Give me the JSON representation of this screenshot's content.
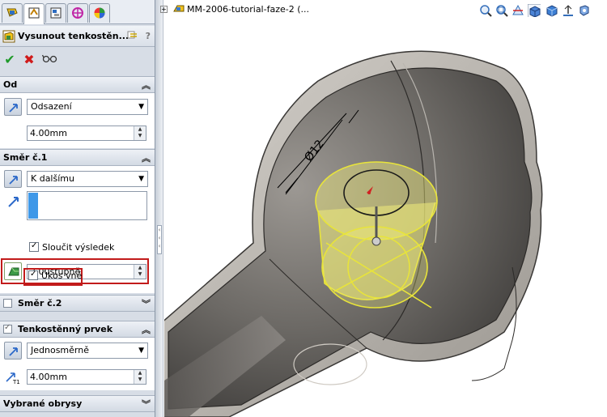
{
  "property_manager": {
    "title": "Vysunout tenkostěn...",
    "help": "?",
    "actions": {
      "ok": "✔",
      "cancel": "✖",
      "preview": "6ō"
    }
  },
  "groups": {
    "od": {
      "title": "Od",
      "select": "Odsazení",
      "value": "4.00mm"
    },
    "smer1": {
      "title": "Směr č.1",
      "select": "K dalšímu",
      "merge_label": "Sloučit výsledek",
      "draft_value": "2.00stupně",
      "draft_out_label": "Úkos vně"
    },
    "smer2": {
      "title": "Směr č.2"
    },
    "thin": {
      "title": "Tenkostěnný prvek",
      "select": "Jednosměrně",
      "value": "4.00mm",
      "t1": "T1"
    },
    "outlines": {
      "title": "Vybrané obrysy"
    }
  },
  "viewport": {
    "tree_title": "MM-2006-tutorial-faze-2  (...",
    "dimension_label": "Ø12",
    "colors": {
      "highlight": "#e8e43a",
      "body": "#7a7774",
      "body_light": "#c9c5bf"
    }
  }
}
